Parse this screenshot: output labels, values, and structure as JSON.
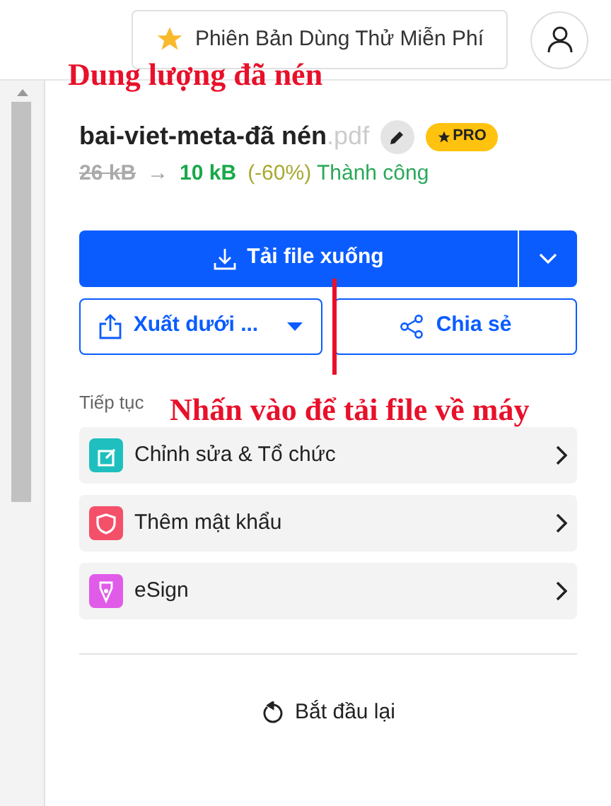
{
  "header": {
    "trial_button": "Phiên Bản Dùng Thử Miễn Phí"
  },
  "file": {
    "name": "bai-viet-meta-đã nén",
    "extension": ".pdf",
    "badge": "PRO",
    "old_size": "26 kB",
    "arrow": "→",
    "new_size": "10 kB",
    "ratio": "(-60%)",
    "status": "Thành công"
  },
  "download_button": "Tải file xuống",
  "export_button": "Xuất dưới ...",
  "share_button": "Chia sẻ",
  "continue_label": "Tiếp tục",
  "actions": [
    {
      "kind": "edit",
      "label": "Chỉnh sửa & Tổ chức",
      "color": "#1fbfbf"
    },
    {
      "kind": "protect",
      "label": "Thêm mật khẩu",
      "color": "#f4506a"
    },
    {
      "kind": "sign",
      "label": "eSign",
      "color": "#e05ce8"
    }
  ],
  "restart_button": "Bắt đầu lại",
  "annotations": [
    "Dung lượng đã nén",
    "Nhấn vào để tải file về máy"
  ]
}
